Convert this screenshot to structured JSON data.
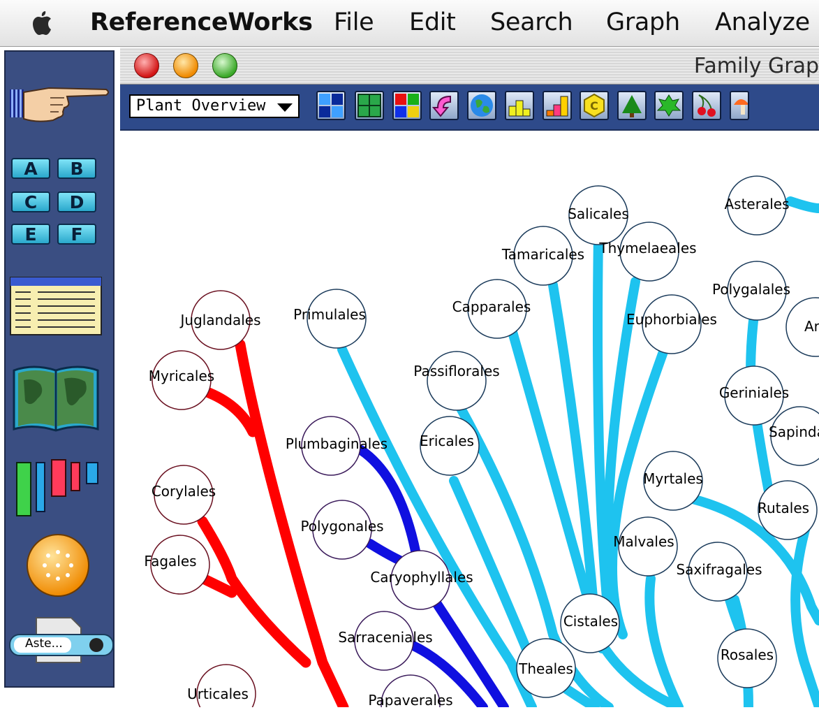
{
  "menubar": {
    "app": "ReferenceWorks",
    "items": [
      "File",
      "Edit",
      "Search",
      "Graph",
      "Analyze"
    ]
  },
  "palette": {
    "grid_letters": [
      "A",
      "B",
      "C",
      "D",
      "E",
      "F"
    ],
    "document_label": "Aste..."
  },
  "window": {
    "title": "Family Grap",
    "dropdown": "Plant Overview"
  },
  "graph": {
    "node_labels": {
      "juglandales": "Juglandales",
      "myricales": "Myricales",
      "corylales": "Corylales",
      "fagales": "Fagales",
      "urticales": "Urticales",
      "primulales": "Primulales",
      "plumbaginales": "Plumbaginales",
      "polygonales": "Polygonales",
      "caryophyllales": "Caryophyllales",
      "sarraceniales": "Sarraceniales",
      "papaverales": "Papaverales",
      "capparales": "Capparales",
      "passiflorales": "Passiflorales",
      "ericales": "Ericales",
      "tamaricales": "Tamaricales",
      "salicales": "Salicales",
      "thymelaeales": "Thymelaeales",
      "euphorbiales": "Euphorbiales",
      "polygalales": "Polygalales",
      "asterales": "Asterales",
      "ariales": "Aria",
      "geriniales": "Geriniales",
      "sapindales": "Sapindal",
      "myrtales": "Myrtales",
      "rutales": "Rutales",
      "malvales": "Malvales",
      "saxifragales": "Saxifragales",
      "cistales": "Cistales",
      "theales": "Theales",
      "rosales": "Rosales"
    },
    "colors": {
      "red": "#ff0000",
      "blue": "#1010e0",
      "cyan": "#1ec3ef"
    }
  }
}
